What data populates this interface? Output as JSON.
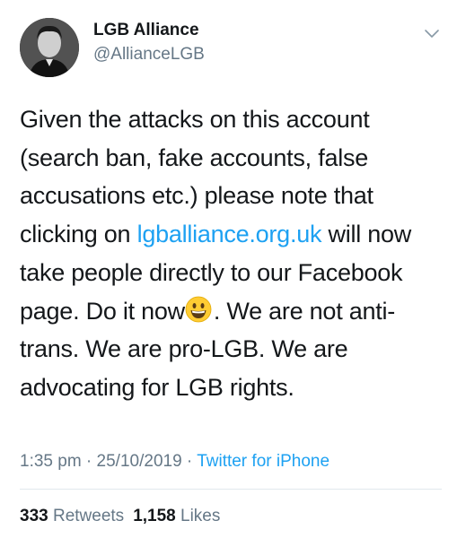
{
  "author": {
    "name": "LGB Alliance",
    "handle": "@AllianceLGB"
  },
  "tweet": {
    "line1": "Given the attacks on this account (search ban, fake accounts, false accusations etc.) please note that clicking on ",
    "link": "lgballiance.org.uk",
    "line2": " will now take people directly to our Facebook page. Do it now",
    "emoji": "grinning-face-emoji",
    "line3": ". We are not anti-trans. We are pro-LGB. We are advocating for LGB rights."
  },
  "meta": {
    "time": "1:35 pm",
    "separator1": " · ",
    "date": "25/10/2019",
    "separator2": " · ",
    "source": "Twitter for iPhone"
  },
  "stats": {
    "retweets_count": "333",
    "retweets_label": "Retweets",
    "likes_count": "1,158",
    "likes_label": "Likes"
  },
  "colors": {
    "link": "#1da1f2",
    "muted": "#657786",
    "text": "#14171a"
  }
}
